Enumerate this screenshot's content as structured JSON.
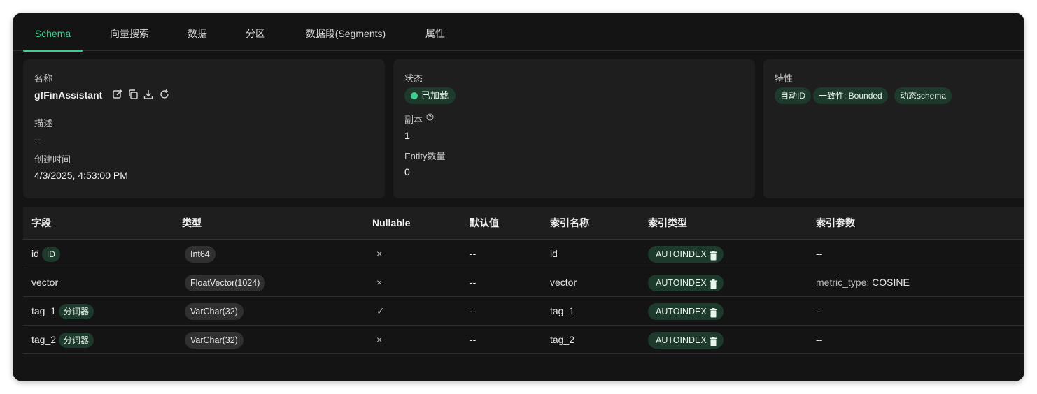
{
  "tabs": [
    {
      "label": "Schema",
      "active": true
    },
    {
      "label": "向量搜索",
      "active": false
    },
    {
      "label": "数据",
      "active": false
    },
    {
      "label": "分区",
      "active": false
    },
    {
      "label": "数据段(Segments)",
      "active": false
    },
    {
      "label": "属性",
      "active": false
    }
  ],
  "info": {
    "name_label": "名称",
    "name_value": "gfFinAssistant",
    "icons": [
      "edit-icon",
      "copy-icon",
      "download-icon",
      "refresh-icon"
    ],
    "desc_label": "描述",
    "desc_value": "--",
    "created_label": "创建时间",
    "created_value": "4/3/2025, 4:53:00 PM"
  },
  "status": {
    "status_label": "状态",
    "status_value": "已加载",
    "replica_label": "副本",
    "replica_value": "1",
    "entity_label": "Entity数量",
    "entity_value": "0"
  },
  "features": {
    "label": "特性",
    "chips": [
      "自动ID",
      "一致性: Bounded",
      "动态schema"
    ]
  },
  "table": {
    "headers": [
      "字段",
      "类型",
      "Nullable",
      "默认值",
      "索引名称",
      "索引类型",
      "索引参数"
    ],
    "rows": [
      {
        "field": "id",
        "field_tag": "ID",
        "type": "Int64",
        "nullable": "×",
        "default": "--",
        "index_name": "id",
        "index_type": "AUTOINDEX",
        "params_key": "",
        "params_value": "--"
      },
      {
        "field": "vector",
        "field_tag": "",
        "type": "FloatVector(1024)",
        "nullable": "×",
        "default": "--",
        "index_name": "vector",
        "index_type": "AUTOINDEX",
        "params_key": "metric_type:",
        "params_value": "COSINE"
      },
      {
        "field": "tag_1",
        "field_tag": "分词器",
        "type": "VarChar(32)",
        "nullable": "✓",
        "default": "--",
        "index_name": "tag_1",
        "index_type": "AUTOINDEX",
        "params_key": "",
        "params_value": "--"
      },
      {
        "field": "tag_2",
        "field_tag": "分词器",
        "type": "VarChar(32)",
        "nullable": "×",
        "default": "--",
        "index_name": "tag_2",
        "index_type": "AUTOINDEX",
        "params_key": "",
        "params_value": "--"
      }
    ]
  },
  "colors": {
    "accent": "#3ecf8e",
    "background": "#141414",
    "card": "#1e1e1e",
    "chip_green": "#1d3a2c"
  }
}
